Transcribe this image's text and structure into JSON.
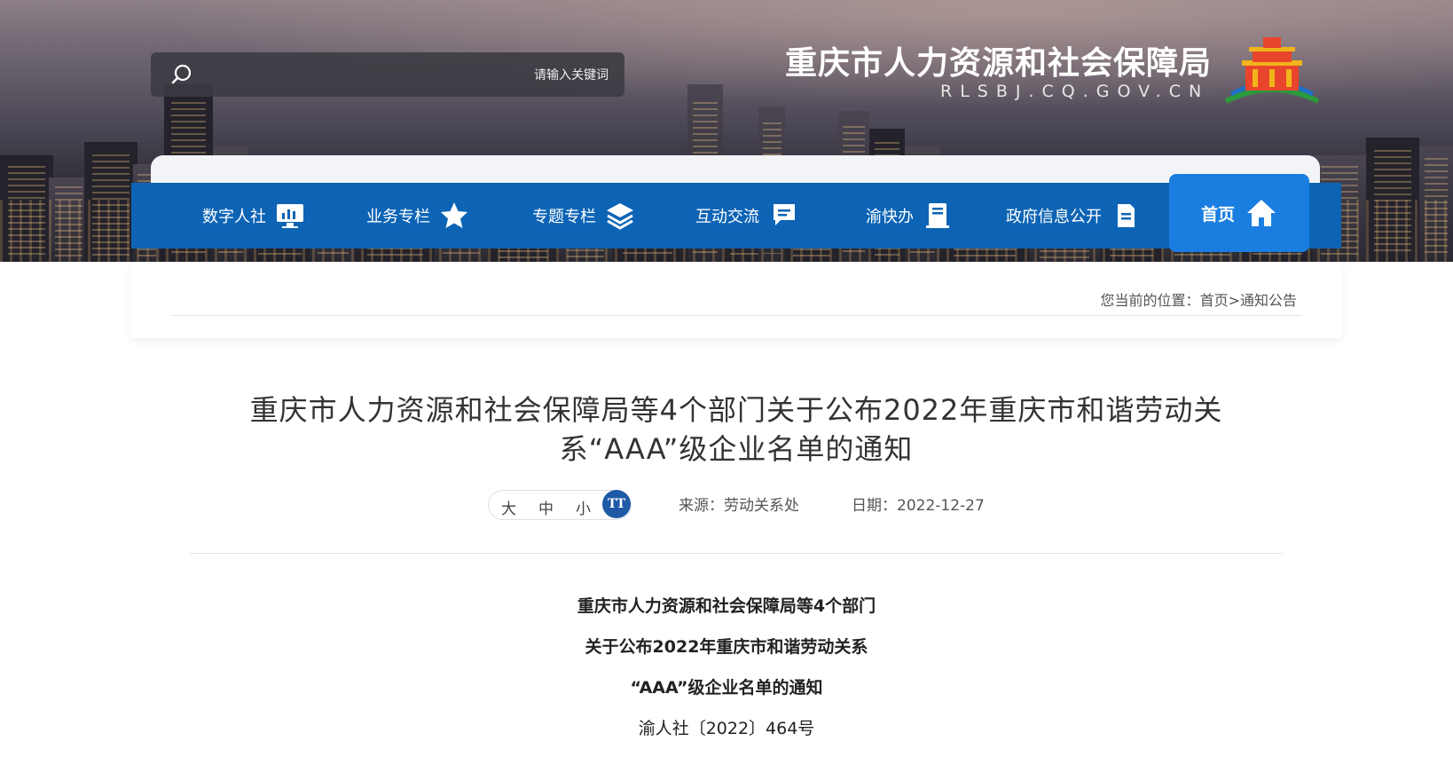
{
  "search": {
    "placeholder": "请输入关键词"
  },
  "logo": {
    "title": "重庆市人力资源和社会保障局",
    "subtitle": "RLSBJ.CQ.GOV.CN"
  },
  "nav": {
    "items": [
      {
        "label": "首页",
        "icon": "home-icon"
      },
      {
        "label": "政府信息公开",
        "icon": "document-icon"
      },
      {
        "label": "渝快办",
        "icon": "clipboard-icon"
      },
      {
        "label": "互动交流",
        "icon": "chat-icon"
      },
      {
        "label": "专题专栏",
        "icon": "layers-icon"
      },
      {
        "label": "业务专栏",
        "icon": "star-icon"
      },
      {
        "label": "数字人社",
        "icon": "monitor-icon"
      }
    ]
  },
  "breadcrumb": {
    "prefix": "您当前的位置：",
    "home": "首页",
    "sep": ">",
    "current": "通知公告"
  },
  "article": {
    "title": "重庆市人力资源和社会保障局等4个部门关于公布2022年重庆市和谐劳动关系“AAA”级企业名单的通知",
    "date_label": "日期：2022-12-27",
    "source_label": "来源：劳动关系处",
    "font_sizes": [
      "大",
      "中",
      "小"
    ],
    "font_icon_text": "TT",
    "body": [
      "重庆市人力资源和社会保障局等4个部门",
      "关于公布2022年重庆市和谐劳动关系",
      "“AAA”级企业名单的通知",
      "渝人社〔2022〕464号"
    ]
  },
  "colors": {
    "nav_bg": "#0d64b5",
    "nav_active": "#1a7ee0",
    "text": "#333333"
  }
}
